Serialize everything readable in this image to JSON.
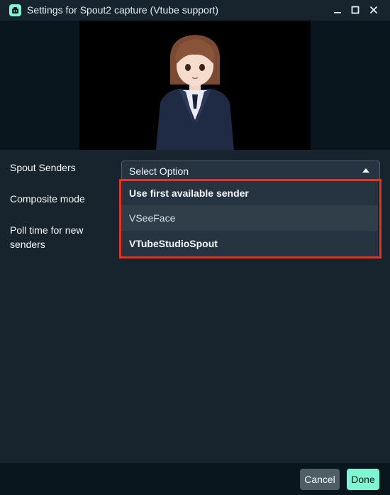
{
  "window": {
    "title": "Settings for Spout2 capture (Vtube support)",
    "icon": "streamlabs-app-icon",
    "controls": [
      "minimize-icon",
      "maximize-icon",
      "close-icon"
    ]
  },
  "form": {
    "spout_senders_label": "Spout Senders",
    "composite_mode_label": "Composite mode",
    "poll_time_label_line1": "Poll time for new",
    "poll_time_label_line2": "senders",
    "select": {
      "value": "Select Option",
      "options": [
        "Use first available sender",
        "VSeeFace",
        "VTubeStudioSpout"
      ]
    }
  },
  "footer": {
    "cancel_label": "Cancel",
    "done_label": "Done"
  },
  "colors": {
    "accent": "#80f5d2",
    "highlight": "#ef2f1e",
    "background": "#17242d"
  }
}
